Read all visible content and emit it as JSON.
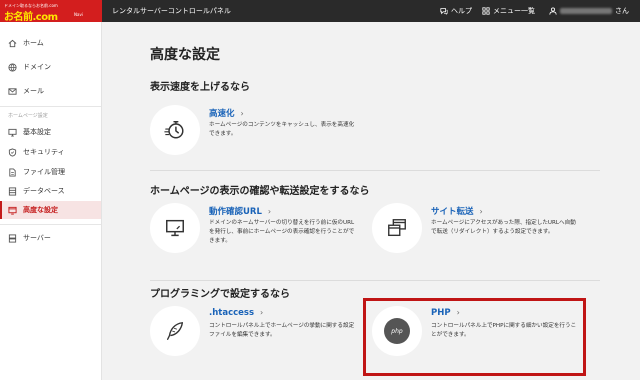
{
  "header": {
    "logo_tagline": "ドメイン取るならお名前.com",
    "logo_brand": "お名前.com",
    "logo_sub": "Navi",
    "title": "レンタルサーバーコントロールパネル",
    "help": "ヘルプ",
    "menu": "メニュー一覧",
    "user_suffix": "さん"
  },
  "sidebar": {
    "home": "ホーム",
    "domain": "ドメイン",
    "mail": "メール",
    "section": "ホームページ設定",
    "basic": "基本設定",
    "security": "セキュリティ",
    "files": "ファイル管理",
    "database": "データベース",
    "advanced": "高度な設定",
    "server": "サーバー"
  },
  "main": {
    "page_title": "高度な設定",
    "sections": [
      {
        "title": "表示速度を上げるなら"
      },
      {
        "title": "ホームページの表示の確認や転送設定をするなら"
      },
      {
        "title": "プログラミングで設定するなら"
      }
    ],
    "cards": {
      "speedup": {
        "title": "高速化",
        "desc": "ホームページのコンテンツをキャッシュし、表示を高速化できます。"
      },
      "check": {
        "title": "動作確認URL",
        "desc": "ドメインのネームサーバーの切り替えを行う前に仮のURLを発行し、事前にホームページの表示確認を行うことができます。"
      },
      "redirect": {
        "title": "サイト転送",
        "desc": "ホームページにアクセスがあった際、指定したURLへ自動で転送（リダイレクト）するよう設定できます。"
      },
      "htaccess": {
        "title": ".htaccess",
        "desc": "コントロールパネル上でホームページの挙動に関する設定ファイルを編集できます。"
      },
      "php": {
        "title": "PHP",
        "badge": "php",
        "desc": "コントロールパネル上でPHPに関する細かい設定を行うことができます。"
      }
    },
    "arrow": "›"
  },
  "colors": {
    "brand_red": "#d31e1e",
    "link_blue": "#1a63b8",
    "highlight": "#c01515"
  }
}
